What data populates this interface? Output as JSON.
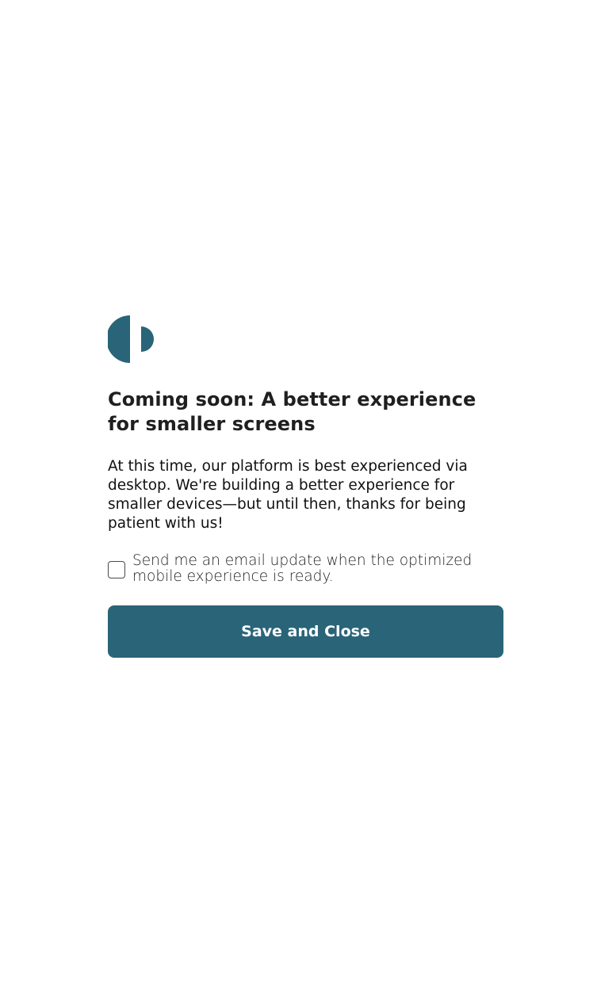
{
  "logo": {
    "icon": "half-circle-logo-icon",
    "color": "#2a6478"
  },
  "modal": {
    "title": "Coming soon: A better experience for smaller screens",
    "body": "At this time, our platform is best experienced via desktop. We're building a better experience for smaller devices—but until then, thanks for being patient with us!",
    "consent": {
      "label": "Send me an email update when the optimized mobile experience is ready.",
      "checked": false
    },
    "primary_button": {
      "label": "Save and Close",
      "color": "#2a6478"
    }
  }
}
